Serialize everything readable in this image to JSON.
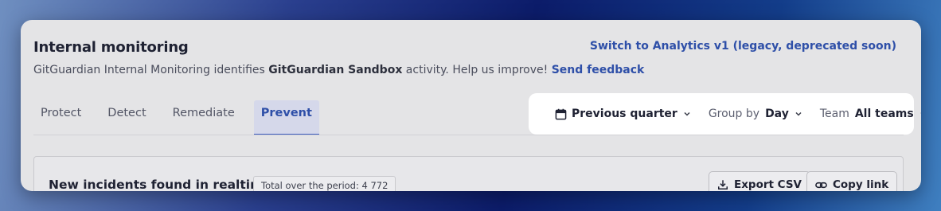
{
  "header": {
    "title": "Internal monitoring",
    "legacy_link": "Switch to Analytics v1 (legacy, deprecated soon)",
    "subtitle_prefix": "GitGuardian Internal Monitoring identifies ",
    "subtitle_org": "GitGuardian Sandbox",
    "subtitle_suffix": " activity. Help us improve! ",
    "feedback_link": "Send feedback"
  },
  "tabs": [
    {
      "label": "Protect",
      "active": false
    },
    {
      "label": "Detect",
      "active": false
    },
    {
      "label": "Remediate",
      "active": false
    },
    {
      "label": "Prevent",
      "active": true
    }
  ],
  "filters": {
    "period": {
      "value": "Previous quarter",
      "icon": "calendar-icon"
    },
    "group_by": {
      "label": "Group by",
      "value": "Day"
    },
    "team": {
      "label": "Team",
      "value": "All teams"
    }
  },
  "card": {
    "title": "New incidents found in realtime",
    "total_badge": "Total over the period: 4 772",
    "export_label": "Export CSV",
    "copy_label": "Copy link"
  },
  "colors": {
    "accent": "#2e4fa8",
    "active_tab_bg": "#d5d8ea",
    "panel_bg": "#e4e4e6"
  }
}
